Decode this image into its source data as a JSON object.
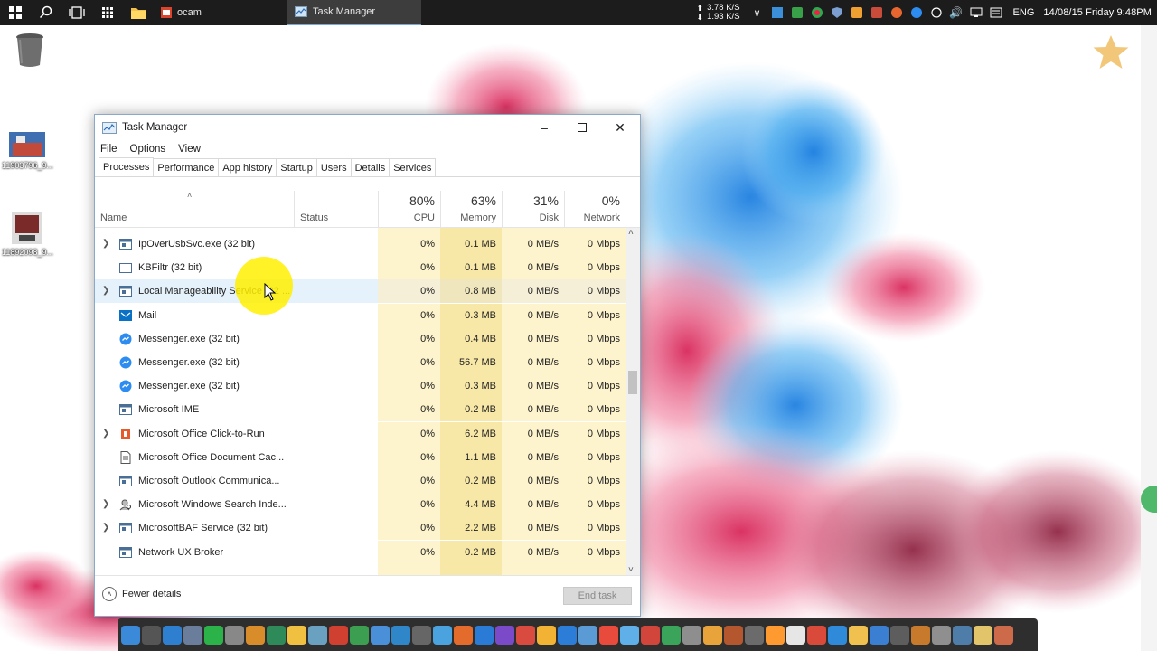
{
  "taskbar": {
    "apps": [
      {
        "label": "ocam"
      },
      {
        "label": "Task Manager"
      }
    ],
    "net_up": "3.78 K/S",
    "net_down": "1.93 K/S",
    "language": "ENG",
    "clock": "14/08/15  Friday  9:48PM"
  },
  "desktop": {
    "icons": [
      {
        "label": "11903796_9..."
      },
      {
        "label": "11892098_9..."
      }
    ]
  },
  "window": {
    "title": "Task Manager",
    "menu": [
      "File",
      "Options",
      "View"
    ],
    "tabs": [
      "Processes",
      "Performance",
      "App history",
      "Startup",
      "Users",
      "Details",
      "Services"
    ],
    "active_tab": "Processes",
    "columns": {
      "name": "Name",
      "status": "Status",
      "cpu": {
        "pct": "80%",
        "label": "CPU"
      },
      "memory": {
        "pct": "63%",
        "label": "Memory"
      },
      "disk": {
        "pct": "31%",
        "label": "Disk"
      },
      "network": {
        "pct": "0%",
        "label": "Network"
      }
    },
    "processes": [
      {
        "name": "IpOverUsbSvc.exe (32 bit)",
        "expandable": true,
        "icon": "service-icon",
        "cpu": "0%",
        "memory": "0.1 MB",
        "disk": "0 MB/s",
        "network": "0 Mbps"
      },
      {
        "name": "KBFiltr (32 bit)",
        "expandable": false,
        "icon": "window-icon",
        "cpu": "0%",
        "memory": "0.1 MB",
        "disk": "0 MB/s",
        "network": "0 Mbps"
      },
      {
        "name": "Local Manageability Service (32 ...",
        "expandable": true,
        "icon": "service-icon",
        "cpu": "0%",
        "memory": "0.8 MB",
        "disk": "0 MB/s",
        "network": "0 Mbps"
      },
      {
        "name": "Mail",
        "expandable": false,
        "icon": "mail-icon",
        "cpu": "0%",
        "memory": "0.3 MB",
        "disk": "0 MB/s",
        "network": "0 Mbps"
      },
      {
        "name": "Messenger.exe (32 bit)",
        "expandable": false,
        "icon": "messenger-icon",
        "cpu": "0%",
        "memory": "0.4 MB",
        "disk": "0 MB/s",
        "network": "0 Mbps"
      },
      {
        "name": "Messenger.exe (32 bit)",
        "expandable": false,
        "icon": "messenger-icon",
        "cpu": "0%",
        "memory": "56.7 MB",
        "disk": "0 MB/s",
        "network": "0 Mbps"
      },
      {
        "name": "Messenger.exe (32 bit)",
        "expandable": false,
        "icon": "messenger-icon",
        "cpu": "0%",
        "memory": "0.3 MB",
        "disk": "0 MB/s",
        "network": "0 Mbps"
      },
      {
        "name": "Microsoft IME",
        "expandable": false,
        "icon": "service-icon",
        "cpu": "0%",
        "memory": "0.2 MB",
        "disk": "0 MB/s",
        "network": "0 Mbps"
      },
      {
        "name": "Microsoft Office Click-to-Run",
        "expandable": true,
        "icon": "office-icon",
        "cpu": "0%",
        "memory": "6.2 MB",
        "disk": "0 MB/s",
        "network": "0 Mbps"
      },
      {
        "name": "Microsoft Office Document Cac...",
        "expandable": false,
        "icon": "document-icon",
        "cpu": "0%",
        "memory": "1.1 MB",
        "disk": "0 MB/s",
        "network": "0 Mbps"
      },
      {
        "name": "Microsoft Outlook Communica...",
        "expandable": false,
        "icon": "service-icon",
        "cpu": "0%",
        "memory": "0.2 MB",
        "disk": "0 MB/s",
        "network": "0 Mbps"
      },
      {
        "name": "Microsoft Windows Search Inde...",
        "expandable": true,
        "icon": "search-user-icon",
        "cpu": "0%",
        "memory": "4.4 MB",
        "disk": "0 MB/s",
        "network": "0 Mbps"
      },
      {
        "name": "MicrosoftBAF Service (32 bit)",
        "expandable": true,
        "icon": "service-icon",
        "cpu": "0%",
        "memory": "2.2 MB",
        "disk": "0 MB/s",
        "network": "0 Mbps"
      },
      {
        "name": "Network UX Broker",
        "expandable": false,
        "icon": "service-icon",
        "cpu": "0%",
        "memory": "0.2 MB",
        "disk": "0 MB/s",
        "network": "0 Mbps"
      }
    ],
    "footer": {
      "fewer_details": "Fewer details",
      "end_task": "End task"
    }
  },
  "colors": {
    "accent": "#7aa7d9",
    "cpu_bg": "#fdf3cc",
    "memory_bg": "#f8e8a8",
    "highlight_row": "#e5f1fb",
    "cursor_highlight": "#fff000"
  }
}
